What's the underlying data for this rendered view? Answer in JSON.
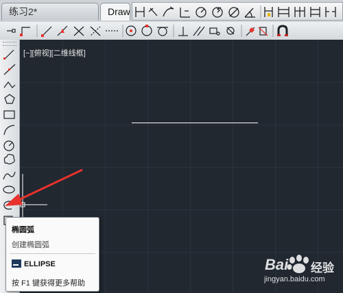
{
  "tabs": [
    {
      "label": "练习2*",
      "active": false
    },
    {
      "label": "Drawi",
      "active": true
    }
  ],
  "viewport": {
    "label": "[−][俯视][二维线框]",
    "background": "#212830"
  },
  "tooltip": {
    "title": "椭圆弧",
    "description": "创建椭圆弧",
    "command": "ELLIPSE",
    "help": "按 F1 键获得更多帮助"
  },
  "watermark": {
    "brand": "Bai",
    "brand_suffix": "经验",
    "url": "jingyan.baidu.com"
  },
  "colors": {
    "annotation_arrow": "#e8322c",
    "accent": "#2b6cb0"
  }
}
